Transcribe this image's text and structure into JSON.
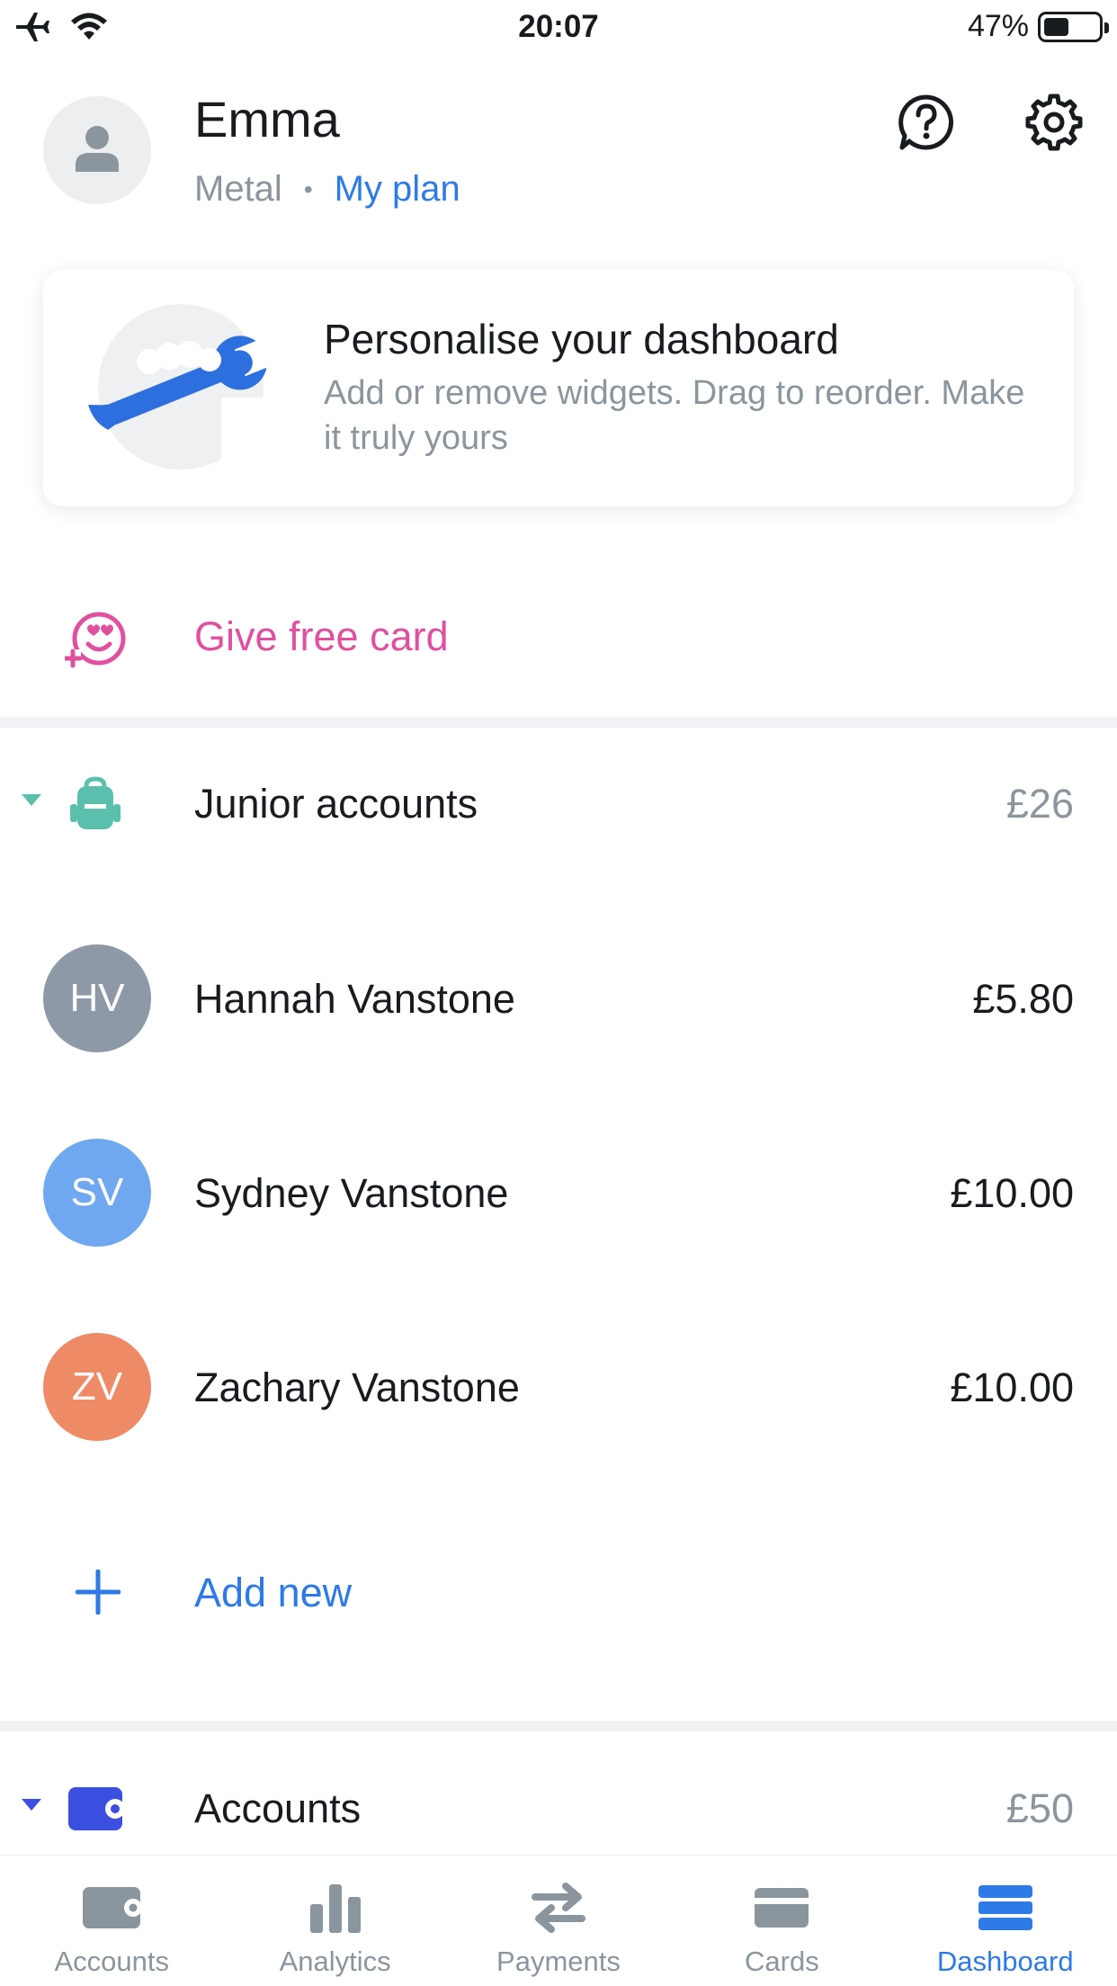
{
  "status_bar": {
    "time": "20:07",
    "battery_percent": "47%",
    "battery_level": 0.47,
    "icons": [
      "airplane-icon",
      "wifi-icon"
    ]
  },
  "profile": {
    "name": "Emma",
    "plan_tier": "Metal",
    "separator": "•",
    "plan_link": "My plan",
    "icons": [
      "avatar-icon",
      "help-icon",
      "gear-icon"
    ]
  },
  "promo": {
    "title": "Personalise your dashboard",
    "body": "Add or remove widgets. Drag to reorder. Make it truly yours",
    "icon": "wrench-illustration"
  },
  "gift": {
    "label": "Give free card",
    "icon": "heart-eyes-icon"
  },
  "junior": {
    "title": "Junior accounts",
    "total": "£26",
    "icon": "backpack-icon",
    "members": [
      {
        "initials": "HV",
        "name": "Hannah Vanstone",
        "amount": "£5.80",
        "color": "#8d99a6"
      },
      {
        "initials": "SV",
        "name": "Sydney Vanstone",
        "amount": "£10.00",
        "color": "#6fa8f0"
      },
      {
        "initials": "ZV",
        "name": "Zachary Vanstone",
        "amount": "£10.00",
        "color": "#ef8a66"
      }
    ],
    "add_label": "Add new"
  },
  "accounts": {
    "title": "Accounts",
    "total": "£50",
    "icon": "wallet-icon"
  },
  "tabs": [
    {
      "label": "Accounts",
      "icon": "wallet-icon",
      "active": false
    },
    {
      "label": "Analytics",
      "icon": "bar-chart-icon",
      "active": false
    },
    {
      "label": "Payments",
      "icon": "transfer-arrows-icon",
      "active": false
    },
    {
      "label": "Cards",
      "icon": "card-icon",
      "active": false
    },
    {
      "label": "Dashboard",
      "icon": "dashboard-icon",
      "active": true
    }
  ],
  "colors": {
    "accent": "#2e7ae6",
    "gift_pink": "#e0509f",
    "junior_teal": "#5bbfae",
    "accounts_blue": "#3b4fe0",
    "muted": "#8b959e"
  }
}
